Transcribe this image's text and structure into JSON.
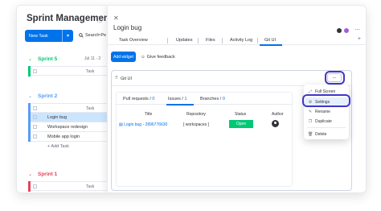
{
  "board": {
    "title": "Sprint Management",
    "new_task_label": "New Task",
    "search_label": "Search",
    "person_fragment": "Pe",
    "groups": [
      {
        "title": "Sprint 5",
        "color": "#00c875",
        "date_fragment": "Jul 11 - 2",
        "col_label": "Task",
        "rows": []
      },
      {
        "title": "Sprint 2",
        "color": "#579bfc",
        "col_label": "Task",
        "rows": [
          "Login bug",
          "Workspace redesign",
          "Mobile app login"
        ],
        "add_label": "+ Add Task"
      },
      {
        "title": "Sprint 1",
        "color": "#e2445c",
        "col_label": "Task",
        "rows": []
      }
    ]
  },
  "panel": {
    "item_title": "Login bug",
    "tabs": [
      "Task Overview",
      "Updates",
      "Files",
      "Activity Log",
      "Git UI"
    ],
    "active_tab": "Git UI",
    "add_widget_label": "Add widget",
    "give_feedback_label": "Give feedback",
    "widget": {
      "title": "Git UI",
      "dots_label": "...",
      "git_tabs": [
        {
          "label": "Pull requests",
          "sep": " / ",
          "count": "0"
        },
        {
          "label": "Issues",
          "sep": " / ",
          "count": "1"
        },
        {
          "label": "Branches",
          "sep": " / ",
          "count": "0"
        }
      ],
      "active_git_tab": "Issues",
      "table": {
        "headers": [
          "Title",
          "Repository",
          "Status",
          "Author"
        ],
        "row": {
          "title": "Login bug - 2896776630",
          "repository": "[ workspaces ]",
          "status": "Open"
        }
      }
    },
    "menu": {
      "items": [
        "Full Screen",
        "Settings",
        "Rename",
        "Duplicate",
        "Delete"
      ],
      "highlighted": "Settings"
    }
  },
  "colors": {
    "primary": "#0073ea",
    "open_status": "#00c875",
    "focus_ring": "#3f37c9",
    "selected_row": "#cce5ff"
  }
}
